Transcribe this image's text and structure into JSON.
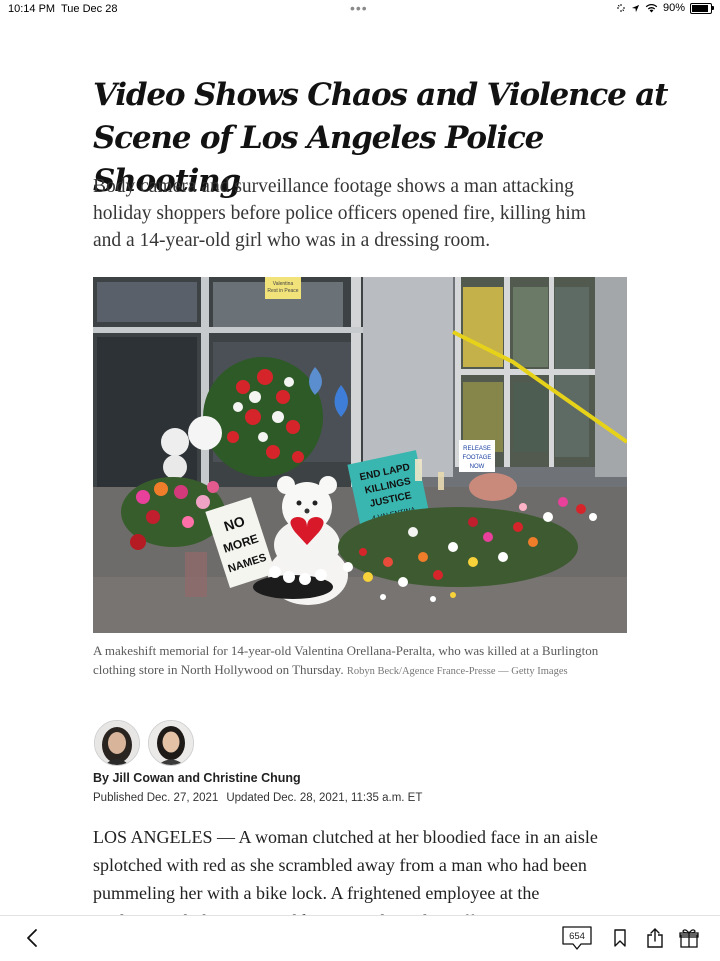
{
  "status_bar": {
    "time": "10:14 PM",
    "date": "Tue Dec 28",
    "battery": "90%",
    "battery_level": 0.9
  },
  "article": {
    "headline": "Video Shows Chaos and Violence at Scene of Los Angeles Police Shooting",
    "summary": "Body camera and surveillance footage shows a man attacking holiday shoppers before police officers opened fire, killing him and a 14-year-old girl who was in a dressing room.",
    "image": {
      "signs": {
        "top_note_1": "Valentina",
        "top_note_2": "Rest in Peace",
        "end_lapd_1": "END LAPD",
        "end_lapd_2": "KILLINGS",
        "end_lapd_3": "JUSTICE",
        "end_lapd_4": "4 VALENTINA",
        "no_more_1": "NO",
        "no_more_2": "MORE",
        "no_more_3": "NAMES",
        "release_1": "RELEASE",
        "release_2": "FOOTAGE",
        "release_3": "NOW"
      }
    },
    "caption": "A makeshift memorial for 14-year-old Valentina Orellana-Peralta, who was killed at a Burlington clothing store in North Hollywood on Thursday.",
    "credit": "Robyn Beck/Agence France-Presse — Getty Images",
    "byline": "By Jill Cowan and Christine Chung",
    "published": "Published Dec. 27, 2021",
    "updated": "Updated Dec. 28, 2021, 11:35 a.m. ET",
    "body": "LOS ANGELES — A woman clutched at her bloodied face in an aisle splotched with red as she scrambled away from a man who had been pummeling her with a bike lock. A frightened employee at the Burlington clothing store told Los Angeles police officers"
  },
  "toolbar": {
    "comment_count": "654",
    "icons": [
      "chevron-left-icon",
      "comment-icon",
      "bookmark-icon",
      "share-icon",
      "gift-icon"
    ]
  }
}
